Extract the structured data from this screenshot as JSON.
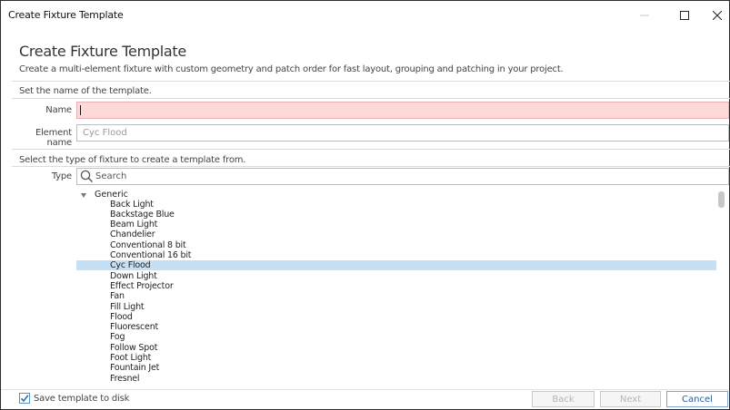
{
  "window": {
    "title": "Create Fixture Template",
    "controls": {
      "minimize": "—",
      "maximize": "☐",
      "close": "✕"
    }
  },
  "dialog": {
    "heading": "Create Fixture Template",
    "subtitle": "Create a multi-element fixture with custom geometry and patch order for fast layout, grouping and patching in your project."
  },
  "name_section": {
    "label": "Set the name of the template.",
    "name_label": "Name",
    "name_value": "",
    "element_label": "Element name",
    "element_placeholder": "Cyc Flood"
  },
  "type_section": {
    "label": "Select the type of fixture to create a template from.",
    "type_label": "Type",
    "search_placeholder": "Search"
  },
  "tree": {
    "group": "Generic",
    "items": [
      "Back Light",
      "Backstage Blue",
      "Beam Light",
      "Chandelier",
      "Conventional 8 bit",
      "Conventional 16 bit",
      "Cyc Flood",
      "Down Light",
      "Effect Projector",
      "Fan",
      "Fill Light",
      "Flood",
      "Fluorescent",
      "Fog",
      "Follow Spot",
      "Foot Light",
      "Fountain Jet",
      "Fresnel"
    ],
    "selected": "Cyc Flood"
  },
  "footer": {
    "save_to_disk_label": "Save template to disk",
    "save_to_disk_checked": true,
    "back_label": "Back",
    "next_label": "Next",
    "cancel_label": "Cancel"
  },
  "colors": {
    "selection": "#c5e0f5",
    "error_field": "#ffd8d8",
    "accent": "#2a5c96"
  }
}
